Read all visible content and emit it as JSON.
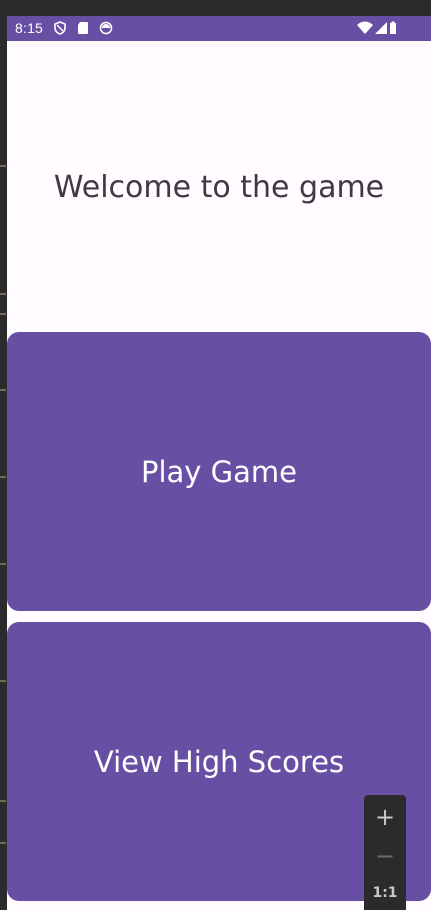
{
  "status_bar": {
    "time": "8:15",
    "background": "#6750a4",
    "left_icons": [
      "shield-icon",
      "sd-card-icon",
      "sync-icon"
    ],
    "right_icons": [
      "wifi-icon",
      "signal-icon",
      "battery-icon"
    ]
  },
  "main": {
    "welcome_text": "Welcome to the game",
    "play_button_label": "Play Game",
    "high_scores_button_label": "View High Scores",
    "accent_color": "#6750a4",
    "background": "#fffbfe"
  },
  "zoom_controls": {
    "zoom_in_label": "+",
    "zoom_out_label": "−",
    "reset_label": "1:1"
  }
}
